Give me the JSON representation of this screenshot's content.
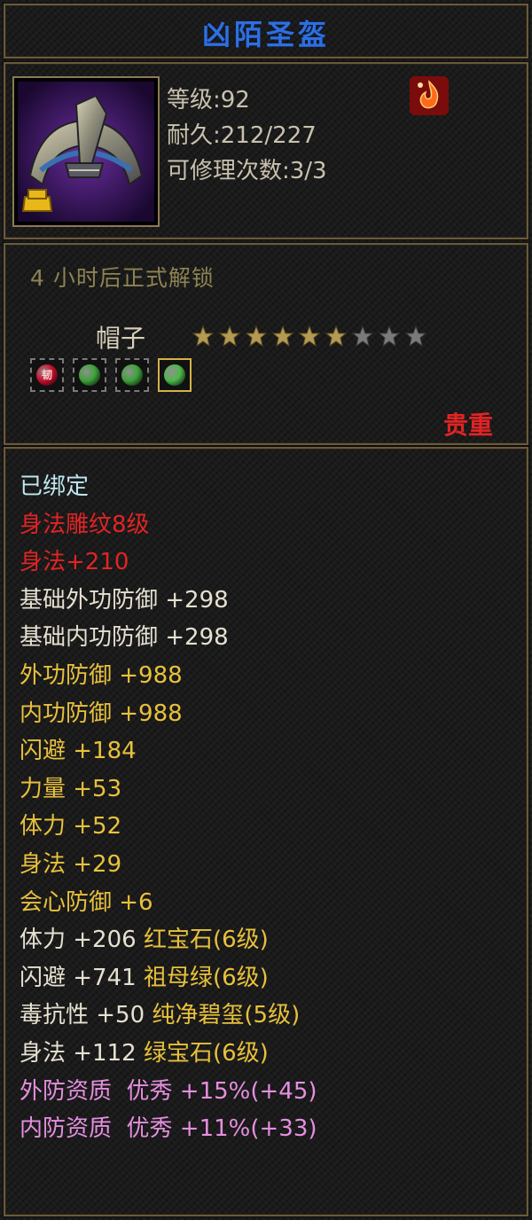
{
  "item": {
    "name": "凶陌圣盔",
    "level_label": "等级:92",
    "durability_label": "耐久:212/227",
    "repair_label": "可修理次数:3/3",
    "unlock_text": "4 小时后正式解锁",
    "slot": "帽子",
    "rarity": "贵重"
  },
  "stars": {
    "filled": 6,
    "total": 9
  },
  "gems": [
    {
      "name": "red-gem-icon",
      "color": "#c8102e",
      "mark": "韧",
      "selected": false
    },
    {
      "name": "green-gem-icon",
      "color": "#3fa33a",
      "mark": "",
      "selected": false
    },
    {
      "name": "green-gem-icon",
      "color": "#3fa33a",
      "mark": "",
      "selected": false
    },
    {
      "name": "emerald-gem-icon",
      "color": "#4fb84a",
      "mark": "",
      "selected": true
    }
  ],
  "colors": {
    "title": "#2e6fe0",
    "bound": "#bfe6f0",
    "red": "#e02424",
    "white": "#e6e0d0",
    "yellow": "#e8c13c",
    "pink": "#e58fe0",
    "rarity": "#e02424"
  },
  "attributes": [
    {
      "text": "已绑定",
      "color": "bound"
    },
    {
      "text": "身法雕纹8级",
      "color": "red"
    },
    {
      "text": "身法+210",
      "color": "red"
    },
    {
      "text": "基础外功防御 +298",
      "color": "white"
    },
    {
      "text": "基础内功防御 +298",
      "color": "white"
    },
    {
      "text": "外功防御 +988",
      "color": "yellow"
    },
    {
      "text": "内功防御 +988",
      "color": "yellow"
    },
    {
      "text": "闪避 +184",
      "color": "yellow"
    },
    {
      "text": "力量 +53",
      "color": "yellow"
    },
    {
      "text": "体力 +52",
      "color": "yellow"
    },
    {
      "text": "身法 +29",
      "color": "yellow"
    },
    {
      "text": "会心防御 +6",
      "color": "yellow"
    },
    {
      "text": "体力 +206 红宝石(6级)",
      "color": "white",
      "split": 8
    },
    {
      "text": "闪避 +741 祖母绿(6级)",
      "color": "white",
      "split": 8
    },
    {
      "text": "毒抗性 +50 纯净碧玺(5级)",
      "color": "white",
      "split": 8
    },
    {
      "text": "身法 +112 绿宝石(6级)",
      "color": "white",
      "split": 8
    },
    {
      "text": "外防资质  优秀 +15%(+45)",
      "color": "pink"
    },
    {
      "text": "内防资质  优秀 +11%(+33)",
      "color": "pink"
    }
  ]
}
